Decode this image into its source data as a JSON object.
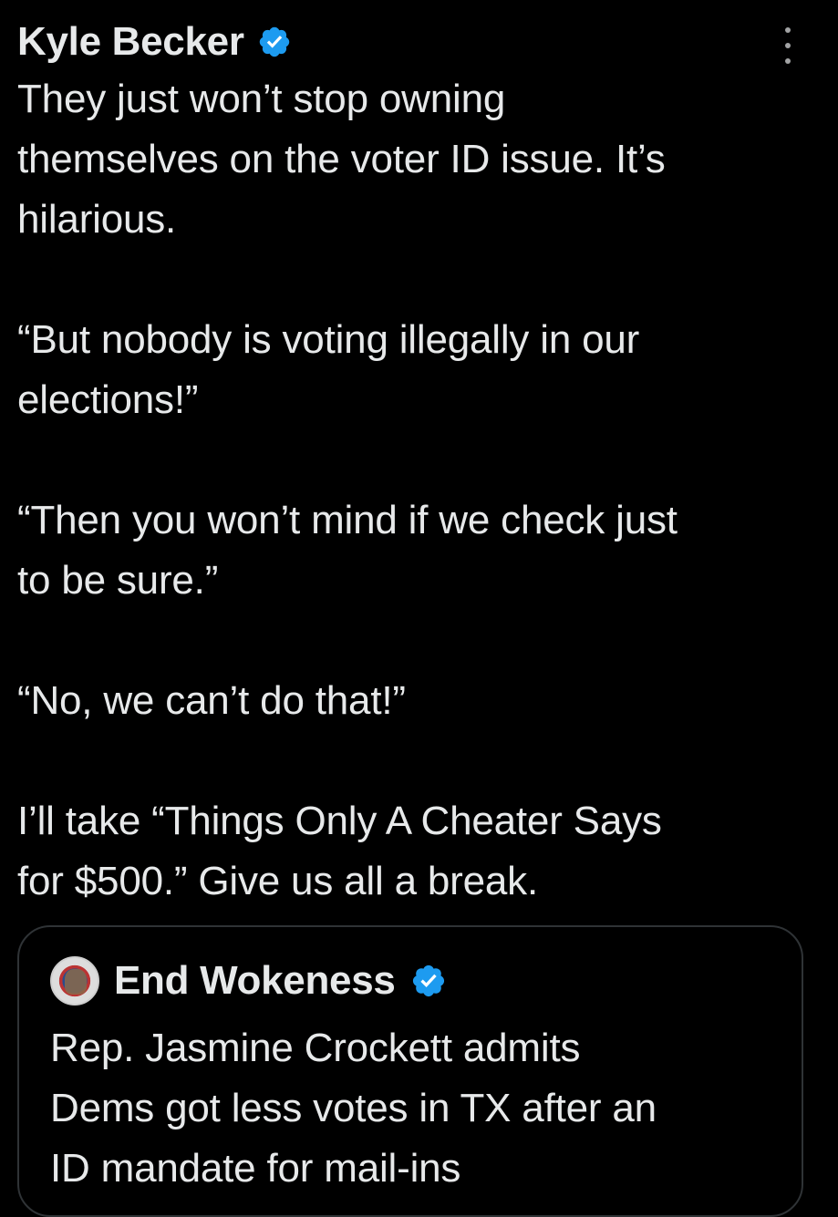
{
  "tweet": {
    "author_name": "Kyle Becker",
    "verified_icon": "verified-badge-icon",
    "more_icon": "more-options-icon",
    "text": "They just won’t stop owning\nthemselves on the voter ID issue. It’s\nhilarious.\n\n“But nobody is voting illegally in our\nelections!”\n\n“Then you won’t mind if we check just\nto be sure.”\n\n“No, we can’t do that!”\n\nI’ll take “Things Only A Cheater Says\nfor $500.” Give us all a break."
  },
  "quoted_tweet": {
    "author_name": "End Wokeness",
    "avatar_icon": "end-wokeness-avatar",
    "verified_icon": "verified-badge-icon",
    "text": "Rep. Jasmine Crockett admits\nDems got less votes in TX after an\nID mandate for mail-ins"
  },
  "colors": {
    "background": "#000000",
    "text": "#e7e9ea",
    "verified": "#1d9bf0",
    "border": "#2f3336"
  }
}
